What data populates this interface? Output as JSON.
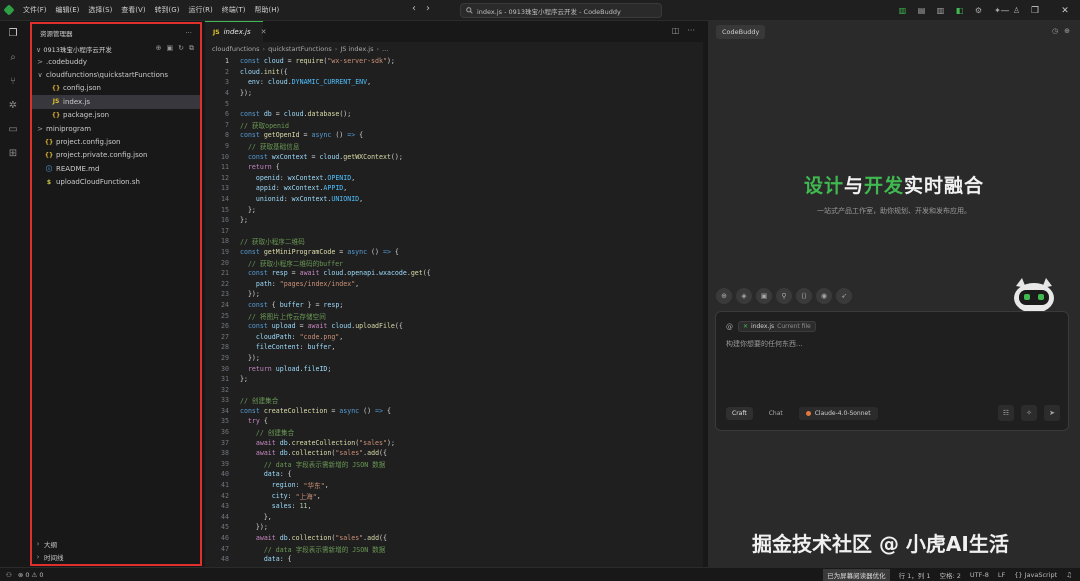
{
  "titlebar": {
    "menus": [
      "文件(F)",
      "编辑(E)",
      "选择(S)",
      "查看(V)",
      "转到(G)",
      "运行(R)",
      "终端(T)",
      "帮助(H)"
    ],
    "search_text": "index.js - 0913珠宝小程序云开发 - CodeBuddy"
  },
  "explorer": {
    "title": "资源管理器",
    "more": "···",
    "project_name": "0913珠宝小程序云开发",
    "tree": [
      {
        "indent": 1,
        "chevron": ">",
        "icon": "",
        "label": ".codebuddy"
      },
      {
        "indent": 1,
        "chevron": "∨",
        "icon": "",
        "label": "cloudfunctions\\quickstartFunctions"
      },
      {
        "indent": 2,
        "chevron": "",
        "icon": "{}",
        "label": "config.json"
      },
      {
        "indent": 2,
        "chevron": "",
        "icon": "JS",
        "label": "index.js",
        "selected": true
      },
      {
        "indent": 2,
        "chevron": "",
        "icon": "{}",
        "label": "package.json"
      },
      {
        "indent": 1,
        "chevron": ">",
        "icon": "",
        "label": "miniprogram"
      },
      {
        "indent": 1,
        "chevron": "",
        "icon": "{}",
        "label": "project.config.json"
      },
      {
        "indent": 1,
        "chevron": "",
        "icon": "{}",
        "label": "project.private.config.json"
      },
      {
        "indent": 1,
        "chevron": "",
        "icon": "ⓘ",
        "label": "README.md"
      },
      {
        "indent": 1,
        "chevron": "",
        "icon": "$",
        "label": "uploadCloudFunction.sh"
      }
    ],
    "bottom_sections": [
      "大纲",
      "时间线"
    ]
  },
  "editor": {
    "tab_label": "index.js",
    "tab_icon": "JS",
    "breadcrumb": [
      "cloudfunctions",
      "quickstartFunctions",
      "JS index.js",
      "..."
    ],
    "current_line": 1,
    "lines": [
      [
        [
          "k",
          "const "
        ],
        [
          "v",
          "cloud"
        ],
        [
          "p",
          " = "
        ],
        [
          "f",
          "require"
        ],
        [
          "p",
          "("
        ],
        [
          "s",
          "\"wx-server-sdk\""
        ],
        [
          "p",
          ");"
        ]
      ],
      [
        [
          "v",
          "cloud"
        ],
        [
          "p",
          "."
        ],
        [
          "f",
          "init"
        ],
        [
          "p",
          "({"
        ]
      ],
      [
        [
          "p",
          "  "
        ],
        [
          "v",
          "env"
        ],
        [
          "p",
          ": "
        ],
        [
          "v",
          "cloud"
        ],
        [
          "p",
          "."
        ],
        [
          "cst",
          "DYNAMIC_CURRENT_ENV"
        ],
        [
          "p",
          ","
        ]
      ],
      [
        [
          "p",
          "});"
        ]
      ],
      [],
      [
        [
          "k",
          "const "
        ],
        [
          "v",
          "db"
        ],
        [
          "p",
          " = "
        ],
        [
          "v",
          "cloud"
        ],
        [
          "p",
          "."
        ],
        [
          "f",
          "database"
        ],
        [
          "p",
          "();"
        ]
      ],
      [
        [
          "c",
          "// 获取openid"
        ]
      ],
      [
        [
          "k",
          "const "
        ],
        [
          "f",
          "getOpenId"
        ],
        [
          "p",
          " = "
        ],
        [
          "k",
          "async "
        ],
        [
          "p",
          "() "
        ],
        [
          "k",
          "=> "
        ],
        [
          "p",
          "{"
        ]
      ],
      [
        [
          "p",
          "  "
        ],
        [
          "c",
          "// 获取基础信息"
        ]
      ],
      [
        [
          "p",
          "  "
        ],
        [
          "k",
          "const "
        ],
        [
          "v",
          "wxContext"
        ],
        [
          "p",
          " = "
        ],
        [
          "v",
          "cloud"
        ],
        [
          "p",
          "."
        ],
        [
          "f",
          "getWXContext"
        ],
        [
          "p",
          "();"
        ]
      ],
      [
        [
          "p",
          "  "
        ],
        [
          "kc",
          "return "
        ],
        [
          "p",
          "{"
        ]
      ],
      [
        [
          "p",
          "    "
        ],
        [
          "v",
          "openid"
        ],
        [
          "p",
          ": "
        ],
        [
          "v",
          "wxContext"
        ],
        [
          "p",
          "."
        ],
        [
          "cst",
          "OPENID"
        ],
        [
          "p",
          ","
        ]
      ],
      [
        [
          "p",
          "    "
        ],
        [
          "v",
          "appid"
        ],
        [
          "p",
          ": "
        ],
        [
          "v",
          "wxContext"
        ],
        [
          "p",
          "."
        ],
        [
          "cst",
          "APPID"
        ],
        [
          "p",
          ","
        ]
      ],
      [
        [
          "p",
          "    "
        ],
        [
          "v",
          "unionid"
        ],
        [
          "p",
          ": "
        ],
        [
          "v",
          "wxContext"
        ],
        [
          "p",
          "."
        ],
        [
          "cst",
          "UNIONID"
        ],
        [
          "p",
          ","
        ]
      ],
      [
        [
          "p",
          "  };"
        ]
      ],
      [
        [
          "p",
          "};"
        ]
      ],
      [],
      [
        [
          "c",
          "// 获取小程序二维码"
        ]
      ],
      [
        [
          "k",
          "const "
        ],
        [
          "f",
          "getMiniProgramCode"
        ],
        [
          "p",
          " = "
        ],
        [
          "k",
          "async "
        ],
        [
          "p",
          "() "
        ],
        [
          "k",
          "=> "
        ],
        [
          "p",
          "{"
        ]
      ],
      [
        [
          "p",
          "  "
        ],
        [
          "c",
          "// 获取小程序二维码的buffer"
        ]
      ],
      [
        [
          "p",
          "  "
        ],
        [
          "k",
          "const "
        ],
        [
          "v",
          "resp"
        ],
        [
          "p",
          " = "
        ],
        [
          "kc",
          "await "
        ],
        [
          "v",
          "cloud"
        ],
        [
          "p",
          "."
        ],
        [
          "v",
          "openapi"
        ],
        [
          "p",
          "."
        ],
        [
          "v",
          "wxacode"
        ],
        [
          "p",
          "."
        ],
        [
          "f",
          "get"
        ],
        [
          "p",
          "({"
        ]
      ],
      [
        [
          "p",
          "    "
        ],
        [
          "v",
          "path"
        ],
        [
          "p",
          ": "
        ],
        [
          "s",
          "\"pages/index/index\""
        ],
        [
          "p",
          ","
        ]
      ],
      [
        [
          "p",
          "  });"
        ]
      ],
      [
        [
          "p",
          "  "
        ],
        [
          "k",
          "const "
        ],
        [
          "p",
          "{ "
        ],
        [
          "v",
          "buffer"
        ],
        [
          "p",
          " } = "
        ],
        [
          "v",
          "resp"
        ],
        [
          "p",
          ";"
        ]
      ],
      [
        [
          "p",
          "  "
        ],
        [
          "c",
          "// 将图片上传云存储空间"
        ]
      ],
      [
        [
          "p",
          "  "
        ],
        [
          "k",
          "const "
        ],
        [
          "v",
          "upload"
        ],
        [
          "p",
          " = "
        ],
        [
          "kc",
          "await "
        ],
        [
          "v",
          "cloud"
        ],
        [
          "p",
          "."
        ],
        [
          "f",
          "uploadFile"
        ],
        [
          "p",
          "({"
        ]
      ],
      [
        [
          "p",
          "    "
        ],
        [
          "v",
          "cloudPath"
        ],
        [
          "p",
          ": "
        ],
        [
          "s",
          "\"code.png\""
        ],
        [
          "p",
          ","
        ]
      ],
      [
        [
          "p",
          "    "
        ],
        [
          "v",
          "fileContent"
        ],
        [
          "p",
          ": "
        ],
        [
          "v",
          "buffer"
        ],
        [
          "p",
          ","
        ]
      ],
      [
        [
          "p",
          "  });"
        ]
      ],
      [
        [
          "p",
          "  "
        ],
        [
          "kc",
          "return "
        ],
        [
          "v",
          "upload"
        ],
        [
          "p",
          "."
        ],
        [
          "v",
          "fileID"
        ],
        [
          "p",
          ";"
        ]
      ],
      [
        [
          "p",
          "};"
        ]
      ],
      [],
      [
        [
          "c",
          "// 创建集合"
        ]
      ],
      [
        [
          "k",
          "const "
        ],
        [
          "f",
          "createCollection"
        ],
        [
          "p",
          " = "
        ],
        [
          "k",
          "async "
        ],
        [
          "p",
          "() "
        ],
        [
          "k",
          "=> "
        ],
        [
          "p",
          "{"
        ]
      ],
      [
        [
          "p",
          "  "
        ],
        [
          "kc",
          "try "
        ],
        [
          "p",
          "{"
        ]
      ],
      [
        [
          "p",
          "    "
        ],
        [
          "c",
          "// 创建集合"
        ]
      ],
      [
        [
          "p",
          "    "
        ],
        [
          "kc",
          "await "
        ],
        [
          "v",
          "db"
        ],
        [
          "p",
          "."
        ],
        [
          "f",
          "createCollection"
        ],
        [
          "p",
          "("
        ],
        [
          "s",
          "\"sales\""
        ],
        [
          "p",
          ");"
        ]
      ],
      [
        [
          "p",
          "    "
        ],
        [
          "kc",
          "await "
        ],
        [
          "v",
          "db"
        ],
        [
          "p",
          "."
        ],
        [
          "f",
          "collection"
        ],
        [
          "p",
          "("
        ],
        [
          "s",
          "\"sales\""
        ],
        [
          "p",
          "."
        ],
        [
          "f",
          "add"
        ],
        [
          "p",
          "({"
        ]
      ],
      [
        [
          "p",
          "      "
        ],
        [
          "c",
          "// data 字段表示需新增的 JSON 数据"
        ]
      ],
      [
        [
          "p",
          "      "
        ],
        [
          "v",
          "data"
        ],
        [
          "p",
          ": {"
        ]
      ],
      [
        [
          "p",
          "        "
        ],
        [
          "v",
          "region"
        ],
        [
          "p",
          ": "
        ],
        [
          "s",
          "\"华东\""
        ],
        [
          "p",
          ","
        ]
      ],
      [
        [
          "p",
          "        "
        ],
        [
          "v",
          "city"
        ],
        [
          "p",
          ": "
        ],
        [
          "s",
          "\"上海\""
        ],
        [
          "p",
          ","
        ]
      ],
      [
        [
          "p",
          "        "
        ],
        [
          "v",
          "sales"
        ],
        [
          "p",
          ": "
        ],
        [
          "n",
          "11"
        ],
        [
          "p",
          ","
        ]
      ],
      [
        [
          "p",
          "      },"
        ]
      ],
      [
        [
          "p",
          "    });"
        ]
      ],
      [
        [
          "p",
          "    "
        ],
        [
          "kc",
          "await "
        ],
        [
          "v",
          "db"
        ],
        [
          "p",
          "."
        ],
        [
          "f",
          "collection"
        ],
        [
          "p",
          "("
        ],
        [
          "s",
          "\"sales\""
        ],
        [
          "p",
          "."
        ],
        [
          "f",
          "add"
        ],
        [
          "p",
          "({"
        ]
      ],
      [
        [
          "p",
          "      "
        ],
        [
          "c",
          "// data 字段表示需新增的 JSON 数据"
        ]
      ],
      [
        [
          "p",
          "      "
        ],
        [
          "v",
          "data"
        ],
        [
          "p",
          ": {"
        ]
      ]
    ]
  },
  "right_panel": {
    "tab_label": "CodeBuddy",
    "hero_part1": "设计",
    "hero_part2": "与",
    "hero_part3": "开发",
    "hero_part4": "实时融合",
    "hero_subtitle": "一站式产品工作室，助你规划、开发和发布应用。",
    "context_file": "index.js",
    "context_tag": "Current file",
    "input_placeholder": "构建你想要的任何东西...",
    "mode_craft": "Craft",
    "mode_chat": "Chat",
    "model_name": "Claude-4.0-Sonnet",
    "accent_color": "#3fb950"
  },
  "watermark": "掘金技术社区 @ 小虎AI生活",
  "statusbar": {
    "problems": "⊗ 0 ⚠ 0",
    "accessibility": "已为屏幕阅读器优化",
    "position": "行 1，列 1",
    "spaces": "空格: 2",
    "encoding": "UTF-8",
    "eol": "LF",
    "language": "{} JavaScript"
  }
}
